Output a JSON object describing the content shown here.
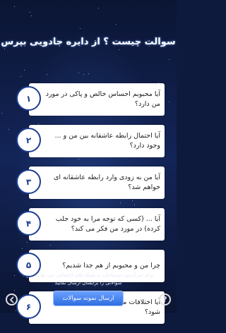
{
  "header": {
    "title": "سوالت چیست ؟ از دایره جادویی بپرس"
  },
  "questions": [
    {
      "number": "۱",
      "text": "آیا محبوبم احساس خالص و پاکی در مورد من دارد؟"
    },
    {
      "number": "۲",
      "text": "آیا احتمال رابطه عاشقانه بین من و ... وجود دارد؟"
    },
    {
      "number": "۳",
      "text": "آیا من به زودی وارد رابطه عاشقانه ای خواهم شد؟"
    },
    {
      "number": "۴",
      "text": "آیا ... (کسی که توجه مرا به خود جلب کرده) در مورد من فکر می کند؟"
    },
    {
      "number": "۵",
      "text": "چرا من و محبوبم از هم جدا شدیم؟"
    },
    {
      "number": "۶",
      "text": "آیا اختلافات ما برای همیشه تمام می شود؟"
    }
  ],
  "footer": {
    "note": "برای سرگرمی دوستانتان در شبکه های اجتماعی می توانید نمونه سوالاتی را برایشان ارسال نمایید",
    "send_button": "ارسال نمونه سوالات",
    "help_label": "?"
  },
  "icons": {
    "exit": "exit-icon",
    "help": "help-icon"
  },
  "colors": {
    "accent": "#1b3e8f",
    "button": "#3f7ef0",
    "background": "#0e1a3d"
  }
}
